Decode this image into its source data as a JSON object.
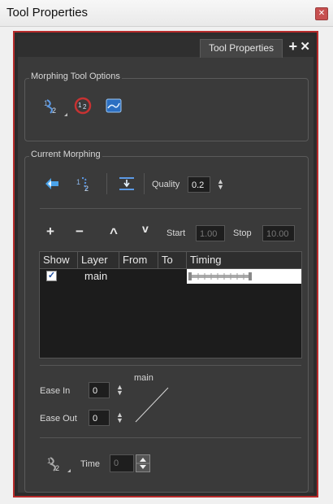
{
  "window": {
    "title": "Tool Properties",
    "close_glyph": "✕"
  },
  "tab": {
    "label": "Tool Properties",
    "plus_glyph": "+",
    "close_glyph": "✕"
  },
  "morphing_tool_options": {
    "title": "Morphing Tool Options",
    "icons": [
      "morph-hint-icon",
      "contour-hint-icon",
      "zone-hint-icon"
    ]
  },
  "current_morphing": {
    "title": "Current Morphing",
    "toolbar_icons": [
      "morphing-forward-icon",
      "morph-hint-flip-icon",
      "align-to-timeline-icon"
    ],
    "quality_label": "Quality",
    "quality_value": "0.2",
    "actions": {
      "add": "+",
      "remove": "−",
      "up": "^",
      "down": "v"
    },
    "start_label": "Start",
    "start_value": "1.00",
    "stop_label": "Stop",
    "stop_value": "10.00",
    "table": {
      "headers": [
        "Show",
        "Layer",
        "From",
        "To",
        "Timing"
      ],
      "rows": [
        {
          "show": true,
          "layer": "main",
          "from": "",
          "to": ""
        }
      ]
    },
    "ease_in_label": "Ease In",
    "ease_in_value": "0",
    "ease_out_label": "Ease Out",
    "ease_out_value": "0",
    "curve_label": "main",
    "time_label": "Time",
    "time_value": "0"
  },
  "colors": {
    "accent_border": "#b72b2b",
    "panel": "#3a3a3a",
    "checkbox_mark": "#1f4ea0"
  }
}
